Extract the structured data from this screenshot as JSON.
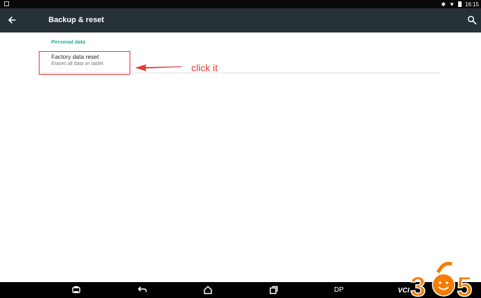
{
  "status_bar": {
    "time": "16:15"
  },
  "action_bar": {
    "title": "Backup & reset",
    "back_icon": "arrow-left-icon",
    "search_icon": "search-icon"
  },
  "section": {
    "header": "Personal data"
  },
  "factory_reset": {
    "title": "Factory data reset",
    "summary": "Erases all data on tablet"
  },
  "annotation": {
    "text": "click it",
    "color": "#e53935"
  },
  "nav_bar": {
    "dp_label": "DP",
    "vci_label": "VCI"
  },
  "logo": {
    "text": "365"
  },
  "colors": {
    "action_bar": "#263238",
    "accent": "#26a69a",
    "highlight": "#e53935"
  }
}
